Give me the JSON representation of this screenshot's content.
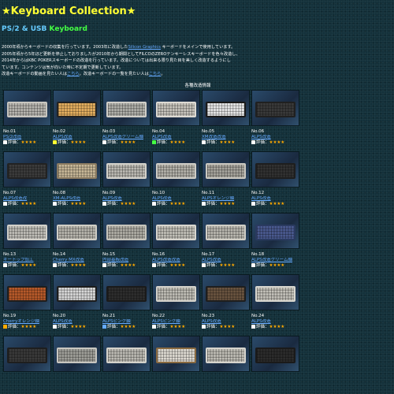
{
  "title": "★Keyboard Collection★",
  "subtitle_ps2": "PS/2 & USB",
  "subtitle_kb": " Keyboard",
  "intro": {
    "line1_a": "2000年頃からキーボードの収集を行っています。2003年に改造した",
    "line1_link": "Silicon Graphics",
    "line1_b": " キーボードをメインで使用しています。",
    "line2": "2005年頃から5年ほど更新を停止しておりましたが2010年から期間としてFILCOのZEROテンキーレスキーボードを色々改造し、",
    "line3": "2014年からはKBC POKERスキーボードの改造を行っています。改造については出来る限り見た目を美しく改造するようにし",
    "line4": "ています。コンテンツは気が向いた時に不定期で更新しています。",
    "line5_a": "改造キーボードの動画を見たい人は",
    "line5_link1": "こちら",
    "line5_b": "。改造キーボードの一覧を見たい人は",
    "line5_link2": "こちら",
    "line5_c": "。"
  },
  "grid_title": "各種改造情報",
  "rating_prefix": "評価：",
  "rows": [
    [
      {
        "num": "No.01",
        "name": "PS/2改造",
        "stars": "★★★★",
        "icon": "#ffffff",
        "case": "#c8c6c0",
        "key": "#b8b6b0"
      },
      {
        "num": "No.02",
        "name": "ALPS改造",
        "stars": "★★★★",
        "icon": "#ffff33",
        "case": "#222222",
        "key": "#e6b060"
      },
      {
        "num": "No.03",
        "name": "ALPS改造クリーム軸",
        "stars": "★★★★",
        "icon": "#ffffff",
        "case": "#d0cec8",
        "key": "#b0b0aa"
      },
      {
        "num": "No.04",
        "name": "ALPS改造",
        "stars": "★★★★",
        "icon": "#44ff44",
        "case": "#dddad3",
        "key": "#c8c5bd"
      },
      {
        "num": "No.05",
        "name": "XM改造改造",
        "stars": "★★★★",
        "icon": "#ffffff",
        "case": "#1a1a1a",
        "key": "#e8e8e8"
      },
      {
        "num": "No.06",
        "name": "ALPS改造",
        "stars": "★★★★",
        "icon": "#ffffff",
        "case": "#202020",
        "key": "#3a3a3a"
      }
    ],
    [
      {
        "num": "No.07",
        "name": "ALPS改造改",
        "stars": "★★★★",
        "icon": "#ffffff",
        "case": "#222222",
        "key": "#3c3c3c"
      },
      {
        "num": "No.08",
        "name": "XM-ALPS改造",
        "stars": "★★★★",
        "icon": "#ffffff",
        "case": "#8a7a60",
        "key": "#c8b898"
      },
      {
        "num": "No.09",
        "name": "ALPS改造",
        "stars": "★★★★",
        "icon": "#ffffff",
        "case": "#d4d2cb",
        "key": "#bdbbb4"
      },
      {
        "num": "No.10",
        "name": "ALPS改造",
        "stars": "★★★★",
        "icon": "#ffffff",
        "case": "#cfcdc6",
        "key": "#b5b3ab"
      },
      {
        "num": "No.11",
        "name": "ALPSオレンジ軸",
        "stars": "★★★★",
        "icon": "#ffffff",
        "case": "#cac8c0",
        "key": "#a8a69e"
      },
      {
        "num": "No.12",
        "name": "ALPS改造",
        "stars": "★★★★",
        "icon": "#ffffff",
        "case": "#1e1e1e",
        "key": "#323232"
      }
    ],
    [
      {
        "num": "No.13",
        "name": "キートップ加工",
        "stars": "★★★★",
        "icon": "#ffffff",
        "case": "#d2d0ca",
        "key": "#c0beb8"
      },
      {
        "num": "No.14",
        "name": "Cherry MX改造",
        "stars": "★★★★",
        "icon": "#ffffff",
        "case": "#d0cec6",
        "key": "#b8b6ae"
      },
      {
        "num": "No.15",
        "name": "内部基板改造",
        "stars": "★★★★",
        "icon": "#ffffff",
        "case": "#c6c4bc",
        "key": "#b0aea6"
      },
      {
        "num": "No.16",
        "name": "ALPS改造改造",
        "stars": "★★★★",
        "icon": "#ffffff",
        "case": "#d8d6cf",
        "key": "#c2c0b8"
      },
      {
        "num": "No.17",
        "name": "ALPS改造",
        "stars": "★★★★",
        "icon": "#ffffff",
        "case": "#d0cec6",
        "key": "#bab8b0"
      },
      {
        "num": "No.18",
        "name": "ALPS改造クリーム軸",
        "stars": "★★★★",
        "icon": "#ffffff",
        "case": "#2a3a60",
        "key": "#4a5a90"
      }
    ],
    [
      {
        "num": "No.19",
        "name": "Cherryオレンジ軸",
        "stars": "★★★★",
        "icon": "#ffaa00",
        "case": "#1e1e1e",
        "key": "#b85a2a"
      },
      {
        "num": "No.20",
        "name": "ALPS改造",
        "stars": "★★★★",
        "icon": "#ffffff",
        "case": "#1c1c1c",
        "key": "#d8d8d8"
      },
      {
        "num": "No.21",
        "name": "ALPSピンク軸",
        "stars": "★★★★",
        "icon": "#66aaff",
        "case": "#1a1a1a",
        "key": "#2e2e2e"
      },
      {
        "num": "No.22",
        "name": "ALPSピンク軸",
        "stars": "★★★★",
        "icon": "#ffffff",
        "case": "#d4d2cb",
        "key": "#c0beb6"
      },
      {
        "num": "No.23",
        "name": "ALPS改造",
        "stars": "★★★★",
        "icon": "#ffffff",
        "case": "#1e1e1e",
        "key": "#6a5440"
      },
      {
        "num": "No.24",
        "name": "ALPS改造",
        "stars": "★★★★",
        "icon": "#ffffff",
        "case": "#d8d6cf",
        "key": "#c4c2ba"
      }
    ],
    [
      {
        "num": "",
        "name": "",
        "stars": "",
        "icon": "",
        "case": "#1e1e1e",
        "key": "#3a3a3a"
      },
      {
        "num": "",
        "name": "",
        "stars": "",
        "icon": "",
        "case": "#c8c6c0",
        "key": "#a0a09a"
      },
      {
        "num": "",
        "name": "",
        "stars": "",
        "icon": "",
        "case": "#d4d2cb",
        "key": "#bdbbb4"
      },
      {
        "num": "",
        "name": "",
        "stars": "",
        "icon": "",
        "case": "#8a6a40",
        "key": "#e0dcd4"
      },
      {
        "num": "",
        "name": "",
        "stars": "",
        "icon": "",
        "case": "#d6d4cd",
        "key": "#c0beb6"
      },
      {
        "num": "",
        "name": "",
        "stars": "",
        "icon": "",
        "case": "#1a1a1a",
        "key": "#2c2c2c"
      }
    ]
  ]
}
